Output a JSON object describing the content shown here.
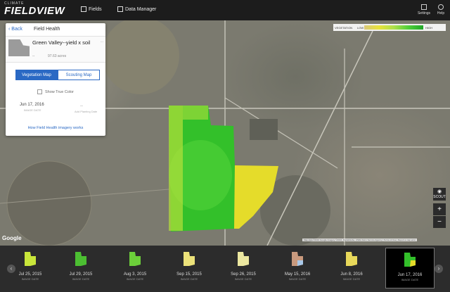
{
  "app": {
    "logo_small": "CLIMATE",
    "logo_big": "FIELDVIEW"
  },
  "nav": {
    "fields": "Fields",
    "data_manager": "Data Manager",
    "settings": "Settings",
    "help": "Help"
  },
  "panel": {
    "back": "Back",
    "title": "Field Health",
    "field_name": "Green Valley--yield x soil",
    "field_sub": "--",
    "acres": "97.63 acres",
    "menu": "...",
    "tab_vegetation": "Vegetation Map",
    "tab_scouting": "Scouting Map",
    "show_true_color": "Show True Color",
    "image_date": "Jun 17, 2016",
    "image_date_sub": "IMAGE DATE",
    "planting_date": "--",
    "planting_date_sub": "Add Planting Date",
    "how_link": "How Field Health imagery works"
  },
  "legend": {
    "label": "VEGETATION",
    "low": "LOW",
    "high": "HIGH"
  },
  "map_controls": {
    "scout": "SCOUT",
    "zoom_in": "+",
    "zoom_out": "−"
  },
  "map_footer": {
    "google": "Google",
    "attribution": "Map data ©2016 Google Imagery ©2016, DigitalGlobe, USDA Farm Service Agency | Terms of Use | Report a map error"
  },
  "timeline": {
    "items": [
      {
        "date": "Jul 25, 2015",
        "sub": "IMAGE DATE"
      },
      {
        "date": "Jul 29, 2015",
        "sub": "IMAGE DATE"
      },
      {
        "date": "Aug 3, 2015",
        "sub": "IMAGE DATE"
      },
      {
        "date": "Sep 15, 2015",
        "sub": "IMAGE DATE"
      },
      {
        "date": "Sep 26, 2015",
        "sub": "IMAGE DATE"
      },
      {
        "date": "May 15, 2016",
        "sub": "IMAGE DATE"
      },
      {
        "date": "Jun 8, 2016",
        "sub": "IMAGE DATE"
      },
      {
        "date": "Jun 17, 2016",
        "sub": "IMAGE DATE"
      }
    ],
    "prev": "‹",
    "next": "›"
  }
}
